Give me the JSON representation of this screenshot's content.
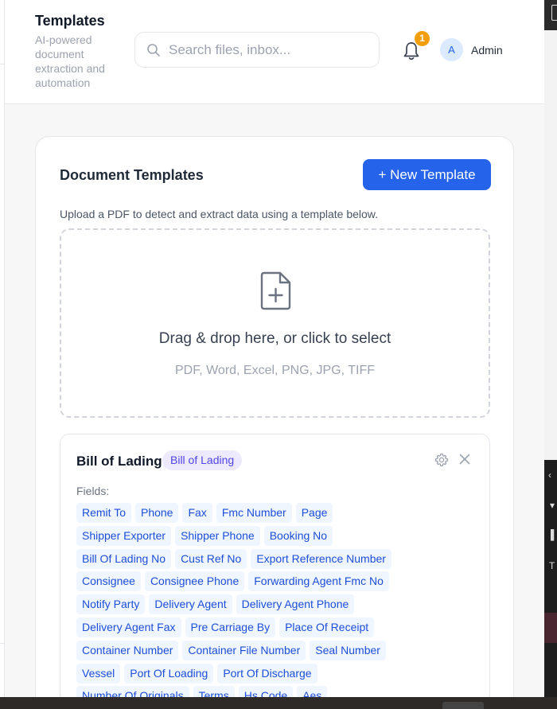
{
  "header": {
    "title": "Templates",
    "subtitle": "AI-powered document extraction and automation",
    "search_placeholder": "Search files, inbox...",
    "notification_count": "1",
    "avatar_initial": "A",
    "user_name": "Admin"
  },
  "main": {
    "title": "Document Templates",
    "new_button": "+ New Template",
    "description": "Upload a PDF to detect and extract data using a template below.",
    "dropzone": {
      "text": "Drag & drop here, or click to select",
      "formats": "PDF, Word, Excel, PNG, JPG, TIFF"
    }
  },
  "template": {
    "name": "Bill of Lading",
    "badge": "Bill of Lading",
    "fields_label": "Fields:",
    "field_rows": [
      [
        "Remit To",
        "Phone",
        "Fax",
        "Fmc Number",
        "Page"
      ],
      [
        "Shipper Exporter",
        "Shipper Phone",
        "Booking No"
      ],
      [
        "Bill Of Lading No",
        "Cust Ref No",
        "Export Reference Number"
      ],
      [
        "Consignee",
        "Consignee Phone",
        "Forwarding Agent Fmc No"
      ],
      [
        "Notify Party",
        "Delivery Agent",
        "Delivery Agent Phone"
      ],
      [
        "Delivery Agent Fax",
        "Pre Carriage By",
        "Place Of Receipt"
      ],
      [
        "Container Number",
        "Container File Number",
        "Seal Number"
      ],
      [
        "Vessel",
        "Port Of Loading",
        "Port Of Discharge"
      ],
      [
        "Number Of Originals",
        "Terms",
        "Hs Code",
        "Aes"
      ]
    ]
  },
  "colors": {
    "accent": "#2563eb",
    "badge_bg": "#ede9fe",
    "chip_bg": "#eff6ff",
    "notification": "#f59e0b"
  },
  "icons": [
    "search-icon",
    "bell-icon",
    "file-plus-icon",
    "gear-icon",
    "close-icon"
  ]
}
